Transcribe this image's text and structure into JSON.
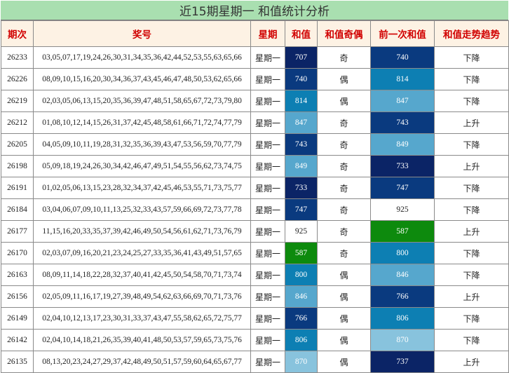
{
  "title": "近15期星期一 和值统计分析",
  "headers": [
    "期次",
    "奖号",
    "星期",
    "和值",
    "和值奇偶",
    "前一次和值",
    "和值走势趋势"
  ],
  "colors": {
    "very_dark": "#0b2466",
    "dark": "#0a3a7f",
    "mid": "#0d7fb3",
    "light": "#56a7cd",
    "pale": "#88c3dd",
    "green": "#0d8a0d",
    "white": "#ffffff"
  },
  "rows": [
    {
      "issue": "26233",
      "numbers": "03,05,07,17,19,24,26,30,31,34,35,36,42,44,52,53,55,63,65,66",
      "weekday": "星期一",
      "sum": "707",
      "sum_color": "very_dark",
      "parity": "奇",
      "prev_sum": "740",
      "prev_color": "dark",
      "trend": "下降"
    },
    {
      "issue": "26226",
      "numbers": "08,09,10,15,16,20,30,34,36,37,43,45,46,47,48,50,53,62,65,66",
      "weekday": "星期一",
      "sum": "740",
      "sum_color": "dark",
      "parity": "偶",
      "prev_sum": "814",
      "prev_color": "mid",
      "trend": "下降"
    },
    {
      "issue": "26219",
      "numbers": "02,03,05,06,13,15,20,35,36,39,47,48,51,58,65,67,72,73,79,80",
      "weekday": "星期一",
      "sum": "814",
      "sum_color": "mid",
      "parity": "偶",
      "prev_sum": "847",
      "prev_color": "light",
      "trend": "下降"
    },
    {
      "issue": "26212",
      "numbers": "01,08,10,12,14,15,26,31,37,42,45,48,58,61,66,71,72,74,77,79",
      "weekday": "星期一",
      "sum": "847",
      "sum_color": "light",
      "parity": "奇",
      "prev_sum": "743",
      "prev_color": "dark",
      "trend": "上升"
    },
    {
      "issue": "26205",
      "numbers": "04,05,09,10,11,19,28,31,32,35,36,39,43,47,53,56,59,70,77,79",
      "weekday": "星期一",
      "sum": "743",
      "sum_color": "dark",
      "parity": "奇",
      "prev_sum": "849",
      "prev_color": "light",
      "trend": "下降"
    },
    {
      "issue": "26198",
      "numbers": "05,09,18,19,24,26,30,34,42,46,47,49,51,54,55,56,62,73,74,75",
      "weekday": "星期一",
      "sum": "849",
      "sum_color": "light",
      "parity": "奇",
      "prev_sum": "733",
      "prev_color": "very_dark",
      "trend": "上升"
    },
    {
      "issue": "26191",
      "numbers": "01,02,05,06,13,15,23,28,32,34,37,42,45,46,53,55,71,73,75,77",
      "weekday": "星期一",
      "sum": "733",
      "sum_color": "very_dark",
      "parity": "奇",
      "prev_sum": "747",
      "prev_color": "dark",
      "trend": "下降"
    },
    {
      "issue": "26184",
      "numbers": "03,04,06,07,09,10,11,13,25,32,33,43,57,59,66,69,72,73,77,78",
      "weekday": "星期一",
      "sum": "747",
      "sum_color": "dark",
      "parity": "奇",
      "prev_sum": "925",
      "prev_color": "white",
      "trend": "下降"
    },
    {
      "issue": "26177",
      "numbers": "11,15,16,20,33,35,37,39,42,46,49,50,54,56,61,62,71,73,76,79",
      "weekday": "星期一",
      "sum": "925",
      "sum_color": "white",
      "parity": "奇",
      "prev_sum": "587",
      "prev_color": "green",
      "trend": "上升"
    },
    {
      "issue": "26170",
      "numbers": "02,03,07,09,16,20,21,23,24,25,27,33,35,36,41,43,49,51,57,65",
      "weekday": "星期一",
      "sum": "587",
      "sum_color": "green",
      "parity": "奇",
      "prev_sum": "800",
      "prev_color": "mid",
      "trend": "下降"
    },
    {
      "issue": "26163",
      "numbers": "08,09,11,14,18,22,28,32,37,40,41,42,45,50,54,58,70,71,73,74",
      "weekday": "星期一",
      "sum": "800",
      "sum_color": "mid",
      "parity": "偶",
      "prev_sum": "846",
      "prev_color": "light",
      "trend": "下降"
    },
    {
      "issue": "26156",
      "numbers": "02,05,09,11,16,17,19,27,39,48,49,54,62,63,66,69,70,71,73,76",
      "weekday": "星期一",
      "sum": "846",
      "sum_color": "light",
      "parity": "偶",
      "prev_sum": "766",
      "prev_color": "dark",
      "trend": "上升"
    },
    {
      "issue": "26149",
      "numbers": "02,04,10,12,13,17,23,30,31,33,37,43,47,55,58,62,65,72,75,77",
      "weekday": "星期一",
      "sum": "766",
      "sum_color": "dark",
      "parity": "偶",
      "prev_sum": "806",
      "prev_color": "mid",
      "trend": "下降"
    },
    {
      "issue": "26142",
      "numbers": "02,04,10,14,18,21,26,35,39,40,41,48,50,53,57,59,65,73,75,76",
      "weekday": "星期一",
      "sum": "806",
      "sum_color": "mid",
      "parity": "偶",
      "prev_sum": "870",
      "prev_color": "pale",
      "trend": "下降"
    },
    {
      "issue": "26135",
      "numbers": "08,13,20,23,24,27,29,37,42,48,49,50,51,57,59,60,64,65,67,77",
      "weekday": "星期一",
      "sum": "870",
      "sum_color": "pale",
      "parity": "偶",
      "prev_sum": "737",
      "prev_color": "very_dark",
      "trend": "上升"
    }
  ]
}
